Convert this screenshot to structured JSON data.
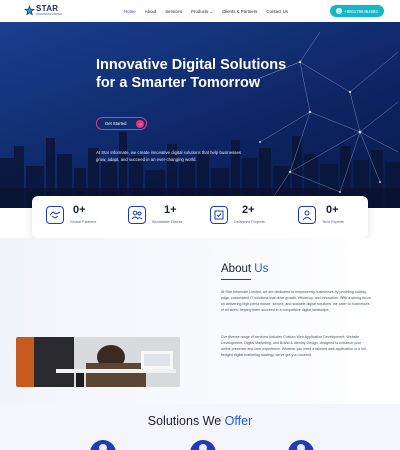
{
  "brand": {
    "name": "STAR",
    "tagline": "INFORMATE LIMITED",
    "accent": "#1f3cb8",
    "cta_color": "#e43b7b",
    "phone_color": "#12b8c9"
  },
  "nav": {
    "items": [
      {
        "label": "Home",
        "active": true
      },
      {
        "label": "About",
        "active": false
      },
      {
        "label": "Services",
        "active": false
      },
      {
        "label": "Products",
        "active": false,
        "dropdown": true
      },
      {
        "label": "Clients & Partners",
        "active": false
      },
      {
        "label": "Contact Us",
        "active": false
      }
    ],
    "phone": "+8801796464883",
    "caret": "⌄"
  },
  "hero": {
    "title_line1": "Innovative Digital Solutions",
    "title_line2": "for a Smarter Tomorrow",
    "cta_label": "Get Started",
    "cta_arrow": "→",
    "description": "At Star Informate, we create innovative digital solutions that help businesses grow, adapt, and succeed in an ever-changing world."
  },
  "stats": [
    {
      "value": "0+",
      "label": "Global Partners",
      "icon": "handshake-icon"
    },
    {
      "value": "1+",
      "label": "Worldwide Clients",
      "icon": "users-icon"
    },
    {
      "value": "2+",
      "label": "Delivered Projects",
      "icon": "project-icon"
    },
    {
      "value": "0+",
      "label": "Tech Experts",
      "icon": "expert-icon"
    }
  ],
  "about": {
    "heading": "About",
    "heading_accent": "Us",
    "paragraph1": "At Star Informate Limited, we are dedicated to empowering businesses by providing cutting-edge, customized IT solutions that drive growth, efficiency, and innovation. With a strong focus on delivering high-performance, secure, and scalable digital solutions, we cater to businesses of all sizes, helping them succeed in a competitive digital landscape.",
    "paragraph2": "Our diverse range of services includes Custom Web Application Development, Website Development, Digital Marketing, and Brand & Identity Design, designed to enhance your online presence and user experience. Whether you need a tailored web application or a full-fledged digital marketing strategy, we've got you covered."
  },
  "solutions": {
    "heading": "Solutions We",
    "heading_accent": "Offer"
  }
}
